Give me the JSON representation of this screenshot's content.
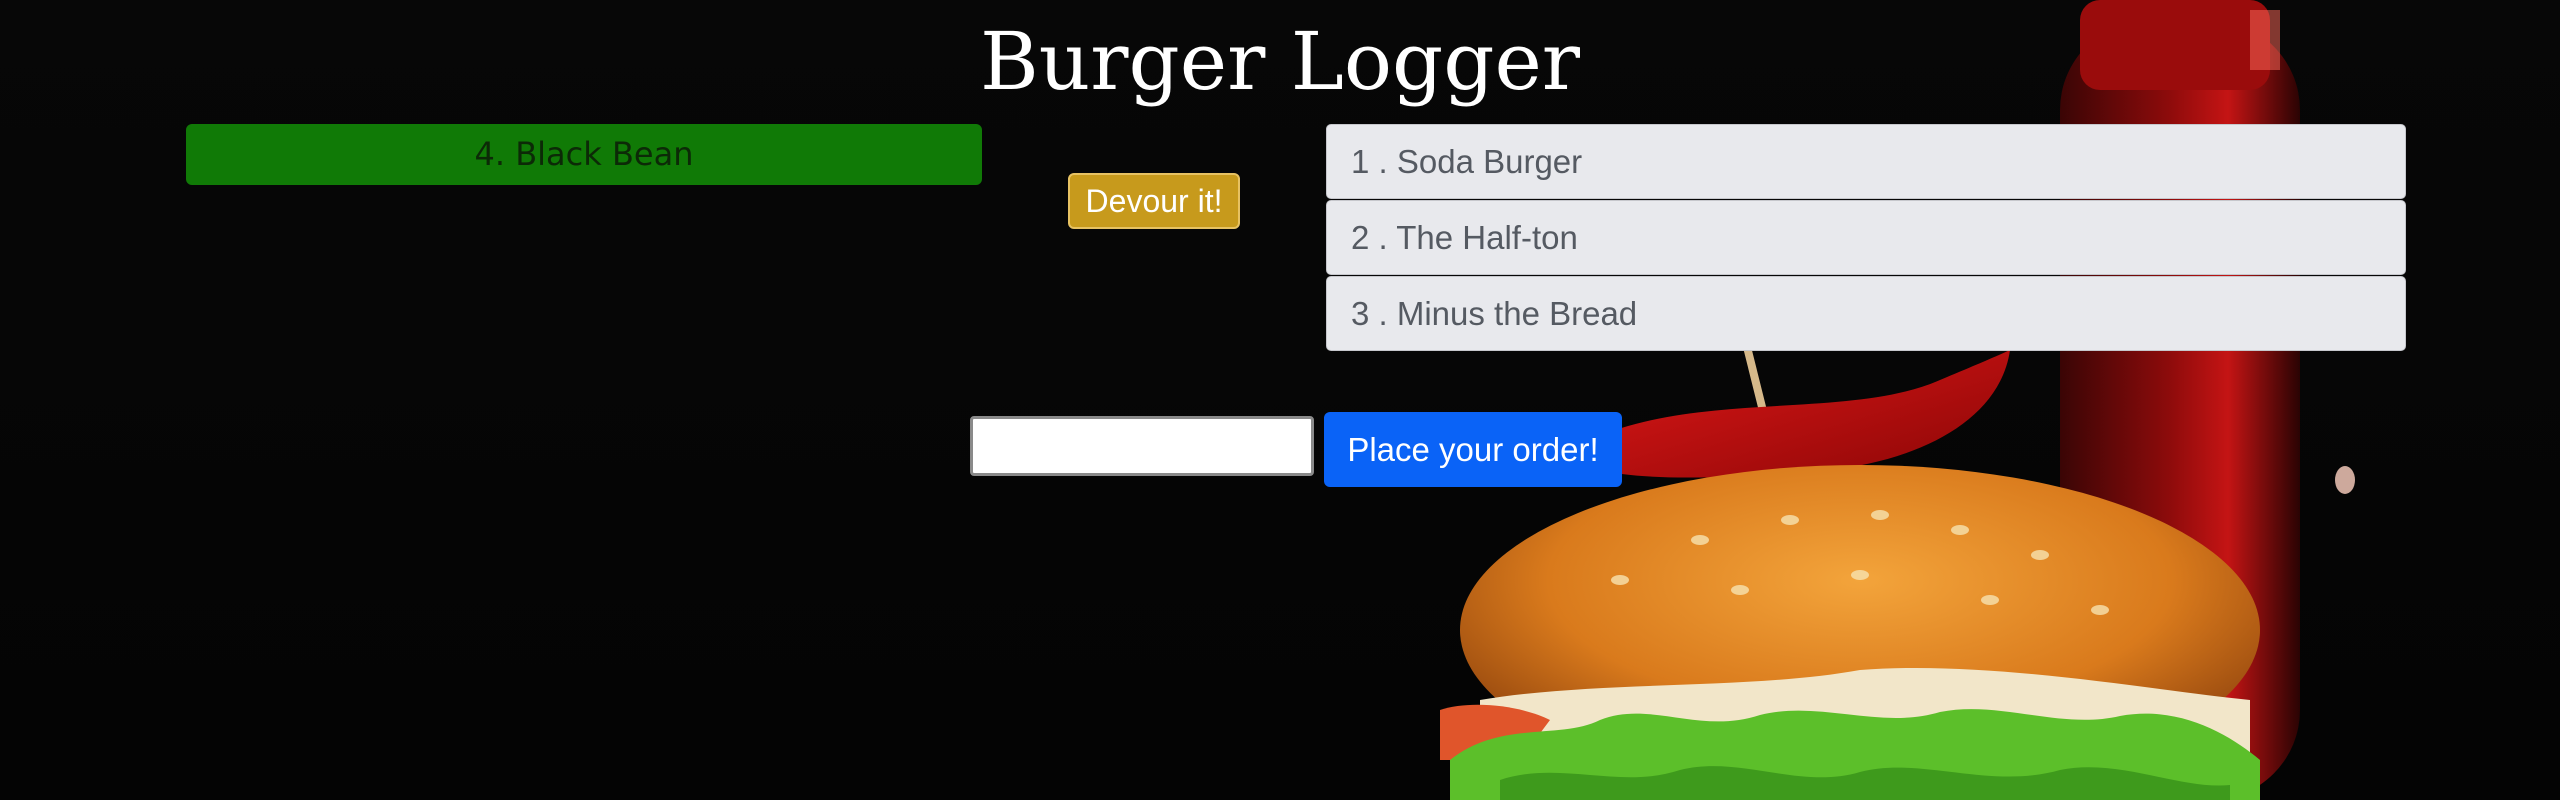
{
  "header": {
    "title": "Burger Logger"
  },
  "devoured": {
    "items": [
      {
        "label": "4. Black Bean"
      }
    ]
  },
  "actions": {
    "devour_label": "Devour it!"
  },
  "menu": {
    "items": [
      {
        "label": "1 . Soda Burger"
      },
      {
        "label": "2 . The Half-ton"
      },
      {
        "label": "3 . Minus the Bread"
      }
    ]
  },
  "order_form": {
    "input_value": "",
    "input_placeholder": "",
    "submit_label": "Place your order!"
  },
  "colors": {
    "devoured_bg": "#107a06",
    "devour_button_bg": "#c79a1c",
    "order_button_bg": "#0a63f7",
    "menu_item_bg": "#e8e9ed"
  },
  "icons": {
    "background_image": "burger-photo"
  }
}
